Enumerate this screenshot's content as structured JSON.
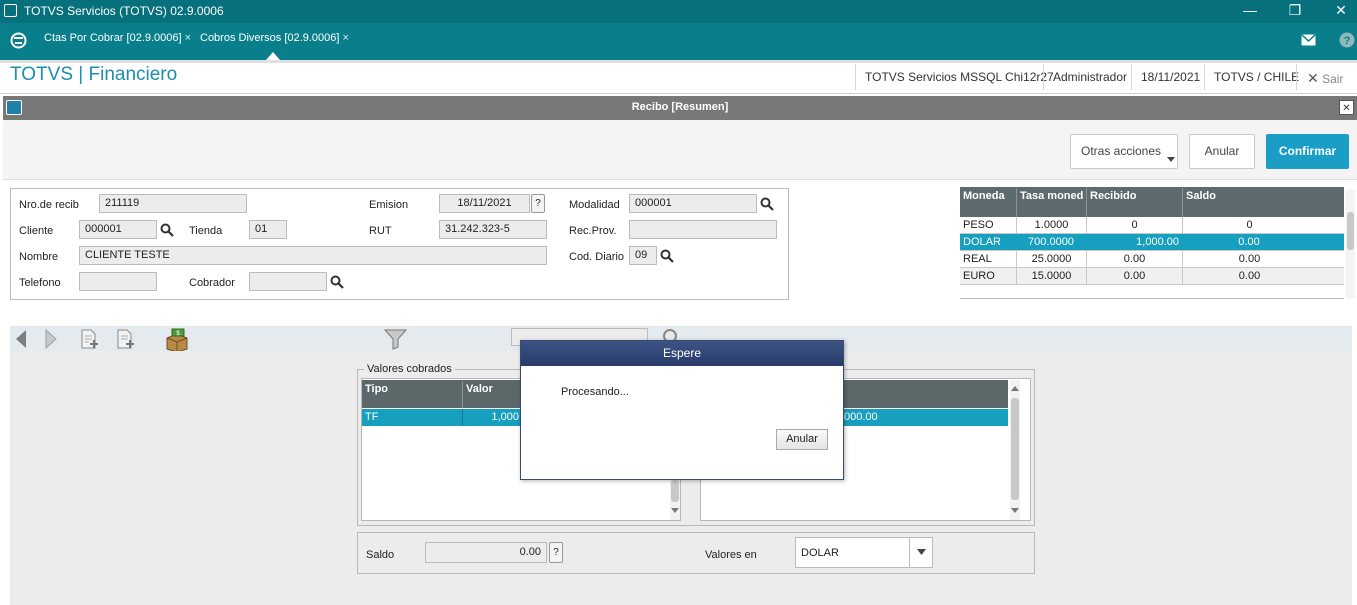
{
  "window": {
    "title": "TOTVS Servicios (TOTVS) 02.9.0006",
    "minimize": "—",
    "restore": "❐",
    "close": "✕"
  },
  "tabs": [
    {
      "label": "Ctas Por Cobrar [02.9.0006]",
      "close": "×"
    },
    {
      "label": "Cobros Diversos [02.9.0006]",
      "close": "×"
    }
  ],
  "header": {
    "brand": "TOTVS | Financiero",
    "database": "TOTVS Servicios MSSQL Chi12r27",
    "user": "Administrador",
    "date": "18/11/2021",
    "company": "TOTVS / CHILE",
    "exit": "Sair"
  },
  "dialog": {
    "title": "Recibo [Resumen]",
    "close": "✕"
  },
  "actions": {
    "otras": "Otras acciones",
    "anular": "Anular",
    "confirmar": "Confirmar"
  },
  "form": {
    "nro_label": "Nro.de recib",
    "nro_value": "211119",
    "emision_label": "Emision",
    "emision_value": "18/11/2021",
    "help": "?",
    "modalidad_label": "Modalidad",
    "modalidad_value": "000001",
    "cliente_label": "Cliente",
    "cliente_value": "000001",
    "tienda_label": "Tienda",
    "tienda_value": "01",
    "rut_label": "RUT",
    "rut_value": "31.242.323-5",
    "recprov_label": "Rec.Prov.",
    "recprov_value": "",
    "nombre_label": "Nombre",
    "nombre_value": "CLIENTE TESTE",
    "coddiario_label": "Cod. Diario",
    "coddiario_value": "09",
    "telefono_label": "Telefono",
    "telefono_value": "",
    "cobrador_label": "Cobrador",
    "cobrador_value": ""
  },
  "currency_table": {
    "headers": [
      "Moneda",
      "Tasa moned",
      "Recibido",
      "Saldo"
    ],
    "rows": [
      {
        "moneda": "PESO",
        "tasa": "1.0000",
        "recibido": "0",
        "saldo": "0"
      },
      {
        "moneda": "DOLAR",
        "tasa": "700.0000",
        "recibido": "1,000.00",
        "saldo": "0.00"
      },
      {
        "moneda": "REAL",
        "tasa": "25.0000",
        "recibido": "0.00",
        "saldo": "0.00"
      },
      {
        "moneda": "EURO",
        "tasa": "15.0000",
        "recibido": "0.00",
        "saldo": "0.00"
      }
    ]
  },
  "valores": {
    "group_label": "Valores cobrados",
    "headers": [
      "Tipo",
      "Valor"
    ],
    "row": {
      "tipo": "TF",
      "valor": "1,000",
      "right_value": "000.00"
    }
  },
  "footer": {
    "saldo_label": "Saldo",
    "saldo_value": "0.00",
    "valores_en_label": "Valores en",
    "valores_en_value": "DOLAR"
  },
  "modal": {
    "title": "Espere",
    "message": "Procesando...",
    "button": "Anular"
  },
  "colors": {
    "titlebar": "#06707c",
    "tabbar": "#0a7f8c",
    "brand": "#1c8fb0",
    "primary": "#1a9ec5",
    "selection": "#169fbf"
  }
}
